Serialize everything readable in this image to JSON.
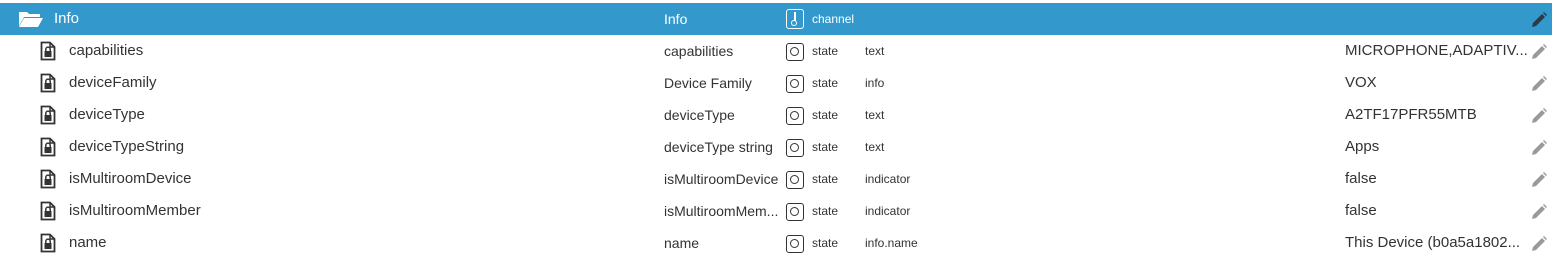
{
  "header": {
    "name": "Info",
    "title": "Info",
    "type": "channel",
    "folder_icon": "folder-open-icon",
    "type_icon": "channel-icon",
    "edit_icon": "pencil-icon",
    "accent_color": "#3399cc"
  },
  "rows": [
    {
      "name": "capabilities",
      "title": "capabilities",
      "type": "state",
      "role": "text",
      "value": "MICROPHONE,ADAPTIV..."
    },
    {
      "name": "deviceFamily",
      "title": "Device Family",
      "type": "state",
      "role": "info",
      "value": "VOX"
    },
    {
      "name": "deviceType",
      "title": "deviceType",
      "type": "state",
      "role": "text",
      "value": "A2TF17PFR55MTB"
    },
    {
      "name": "deviceTypeString",
      "title": "deviceType string",
      "type": "state",
      "role": "text",
      "value": "Apps"
    },
    {
      "name": "isMultiroomDevice",
      "title": "isMultiroomDevice",
      "type": "state",
      "role": "indicator",
      "value": "false"
    },
    {
      "name": "isMultiroomMember",
      "title": "isMultiroomMem...",
      "type": "state",
      "role": "indicator",
      "value": "false"
    },
    {
      "name": "name",
      "title": "name",
      "type": "state",
      "role": "info.name",
      "value": "This Device (b0a5a1802..."
    }
  ],
  "icons": {
    "row_icon": "locked-file-icon",
    "state_icon": "state-icon",
    "edit_icon": "pencil-icon"
  }
}
